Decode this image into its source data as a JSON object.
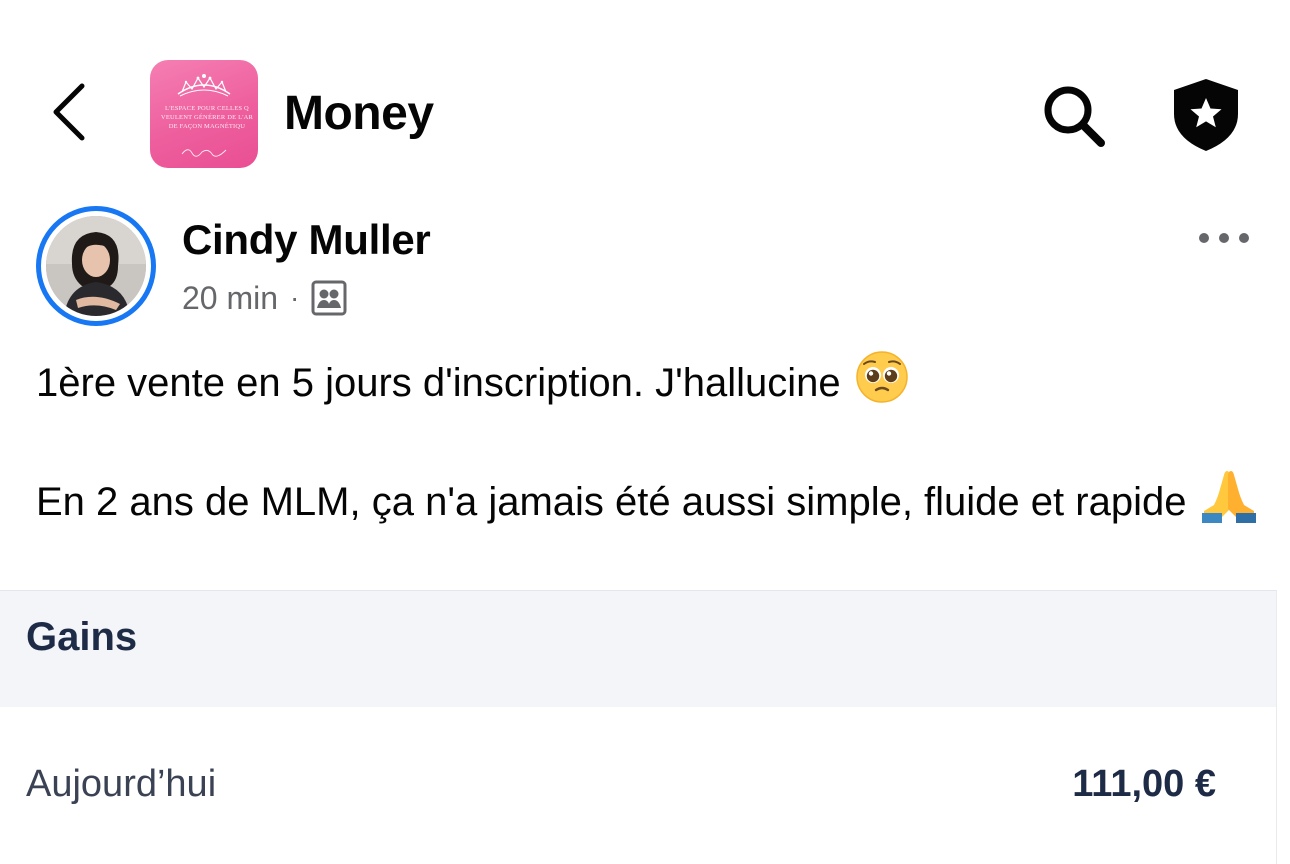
{
  "header": {
    "back_icon": "chevron-left-icon",
    "group_cover_text": "L'ESPACE POUR CELLES Q\nVEULENT GÉNÉRER DE L'AR\nDE FAÇON MAGNÉTIQU",
    "group_title": "Money",
    "search_icon": "search-icon",
    "shield_icon": "shield-star-icon"
  },
  "post": {
    "author": "Cindy Muller",
    "time": "20 min",
    "separator": "·",
    "audience_icon": "group-members-icon",
    "more_icon": "more-dots-icon",
    "line1": "1ère vente en 5 jours d'inscription. J'hallucine",
    "line2": "En 2 ans de MLM, ça n'a jamais été aussi simple, fluide et rapide",
    "emoji1": "pleading-face-emoji",
    "emoji2": "folded-hands-emoji"
  },
  "attachment": {
    "section_title": "Gains",
    "rows": [
      {
        "label": "Aujourd’hui",
        "value": "111,00 €"
      }
    ]
  },
  "colors": {
    "accent": "#1877f2",
    "cover_pink": "#ee5f9e",
    "text_primary": "#050505",
    "text_secondary": "#65676b",
    "gains_band": "#f3f5f8",
    "gains_text": "#1e2b47"
  }
}
